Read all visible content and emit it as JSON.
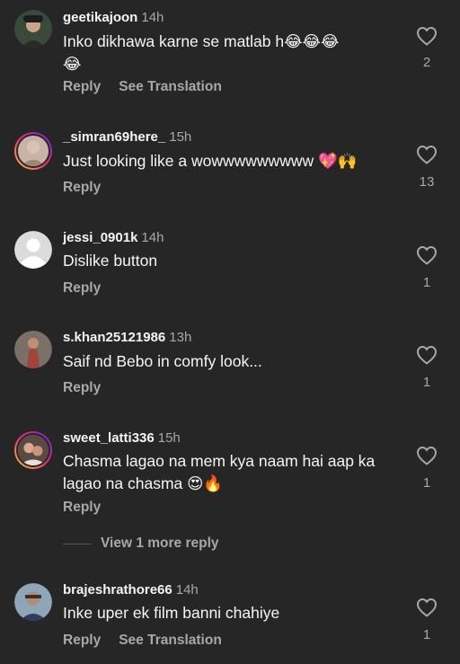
{
  "comments": [
    {
      "username": "geetikajoon",
      "time": "14h",
      "line1": "Inko dikhawa karne se matlab h😂😂😂",
      "line2": "😂",
      "reply": "Reply",
      "translation": "See Translation",
      "likes": "2",
      "avatar": "photo-dark"
    },
    {
      "username": "_simran69here_",
      "time": "15h",
      "line1": "Just looking like a wowwwwwwwww 💖🙌",
      "line2": "",
      "reply": "Reply",
      "translation": "",
      "likes": "13",
      "avatar": "photo-ring"
    },
    {
      "username": "jessi_0901k",
      "time": "14h",
      "line1": "Dislike button",
      "line2": "",
      "reply": "Reply",
      "translation": "",
      "likes": "1",
      "avatar": "default-person"
    },
    {
      "username": "s.khan25121986",
      "time": "13h",
      "line1": "Saif nd Bebo in comfy look...",
      "line2": "",
      "reply": "Reply",
      "translation": "",
      "likes": "1",
      "avatar": "photo-woman"
    },
    {
      "username": "sweet_latti336",
      "time": "15h",
      "line1": "Chasma lagao na mem kya naam hai aap ka",
      "line2": "lagao na chasma 😍🔥",
      "reply": "Reply",
      "translation": "",
      "likes": "1",
      "avatar": "photo-ring"
    },
    {
      "username": "brajeshrathore66",
      "time": "14h",
      "line1": "Inke uper ek film banni chahiye",
      "line2": "",
      "reply": "Reply",
      "translation": "See Translation",
      "likes": "1",
      "avatar": "photo-man"
    }
  ],
  "view_more": "View 1 more reply",
  "colors": {
    "background": "#262626",
    "primary_text": "#f5f5f5",
    "secondary_text": "#a8a8a8"
  }
}
